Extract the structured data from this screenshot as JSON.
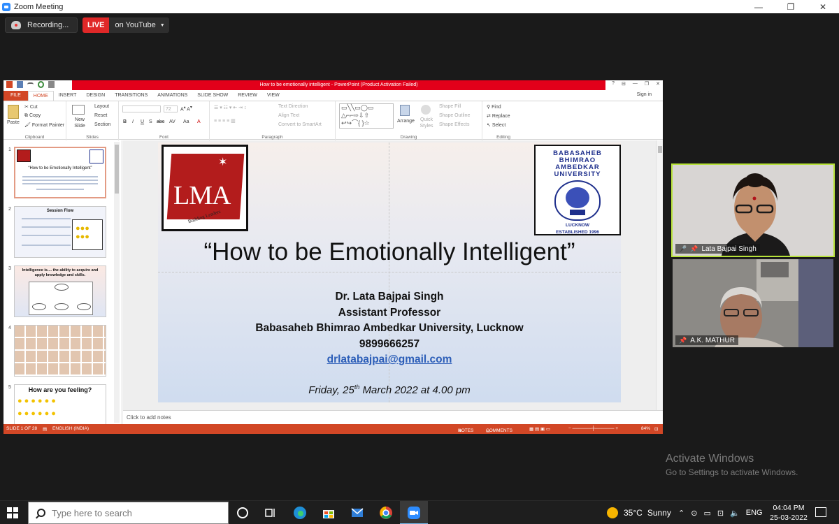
{
  "zoom": {
    "window_title": "Zoom Meeting",
    "recording_label": "Recording...",
    "live_label": "LIVE",
    "live_target": "on YouTube",
    "window_controls": {
      "minimize": "—",
      "restore": "❐",
      "close": "✕"
    }
  },
  "powerpoint": {
    "title": "How to be emotionally intelligent  -  PowerPoint (Product Activation Failed)",
    "window_controls": [
      "?",
      "⊟",
      "—",
      "❐",
      "✕"
    ],
    "tabs": [
      "FILE",
      "HOME",
      "INSERT",
      "DESIGN",
      "TRANSITIONS",
      "ANIMATIONS",
      "SLIDE SHOW",
      "REVIEW",
      "VIEW"
    ],
    "active_tab": "HOME",
    "sign_in": "Sign in",
    "ribbon": {
      "clipboard": {
        "label": "Clipboard",
        "paste": "Paste",
        "cut": "Cut",
        "copy": "Copy",
        "format_painter": "Format Painter"
      },
      "slides": {
        "label": "Slides",
        "new_slide": "New Slide",
        "layout": "Layout",
        "reset": "Reset",
        "section": "Section"
      },
      "font": {
        "label": "Font",
        "font_size": "72",
        "format_buttons": [
          "B",
          "I",
          "U",
          "S",
          "abc",
          "AV",
          "Aa",
          "A"
        ]
      },
      "paragraph": {
        "label": "Paragraph",
        "text_direction": "Text Direction",
        "align_text": "Align Text",
        "convert_smartart": "Convert to SmartArt"
      },
      "drawing": {
        "label": "Drawing",
        "arrange": "Arrange",
        "quick_styles": "Quick Styles",
        "shape_fill": "Shape Fill",
        "shape_outline": "Shape Outline",
        "shape_effects": "Shape Effects"
      },
      "editing": {
        "label": "Editing",
        "find": "Find",
        "replace": "Replace",
        "select": "Select"
      }
    },
    "thumbnails": [
      {
        "number": "1",
        "title": "“How to be Emotionally Intelligent”"
      },
      {
        "number": "2",
        "title": "Session Flow"
      },
      {
        "number": "3",
        "title": "Intelligence is.... the ability to acquire and apply knowledge and skills."
      },
      {
        "number": "4",
        "title": ""
      },
      {
        "number": "5",
        "title": "How are you feeling?"
      }
    ],
    "slide": {
      "lma_logo_text": "LMA",
      "lma_tagline": "Building Leaders",
      "university_logo_lines": [
        "BABASAHEB",
        "BHIMRAO",
        "AMBEDKAR",
        "UNIVERSITY"
      ],
      "university_logo_city": "LUCKNOW",
      "university_logo_established": "ESTABLISHED 1996",
      "title": "“How to be Emotionally Intelligent”",
      "presenter": "Dr. Lata Bajpai Singh",
      "role": "Assistant Professor",
      "university": "Babasaheb Bhimrao Ambedkar University, Lucknow",
      "phone": "9899666257",
      "email": "drlatabajpai@gmail.com",
      "date_prefix": "Friday, 25",
      "date_sup": "th",
      "date_suffix": " March 2022 at 4.00 pm"
    },
    "notes_placeholder": "Click to add notes",
    "status": {
      "slide_counter": "SLIDE 1 OF 28",
      "language": "ENGLISH (INDIA)",
      "notes": "NOTES",
      "comments": "COMMENTS",
      "zoom": "84%"
    }
  },
  "participants": [
    {
      "name": "Lata Bajpai Singh",
      "active_speaker": true
    },
    {
      "name": "A.K. MATHUR",
      "active_speaker": false
    }
  ],
  "activate_windows": {
    "title": "Activate Windows",
    "subtitle": "Go to Settings to activate Windows."
  },
  "taskbar": {
    "search_placeholder": "Type here to search",
    "weather_temp": "35°C",
    "weather_text": "Sunny",
    "language": "ENG",
    "time": "04:04 PM",
    "date": "25-03-2022"
  },
  "colors": {
    "ppt_accent": "#d24726",
    "activation_bar": "#e2001a",
    "live_red": "#e02828",
    "active_speaker_border": "#b7e23a",
    "email_link": "#2c5eb8"
  }
}
